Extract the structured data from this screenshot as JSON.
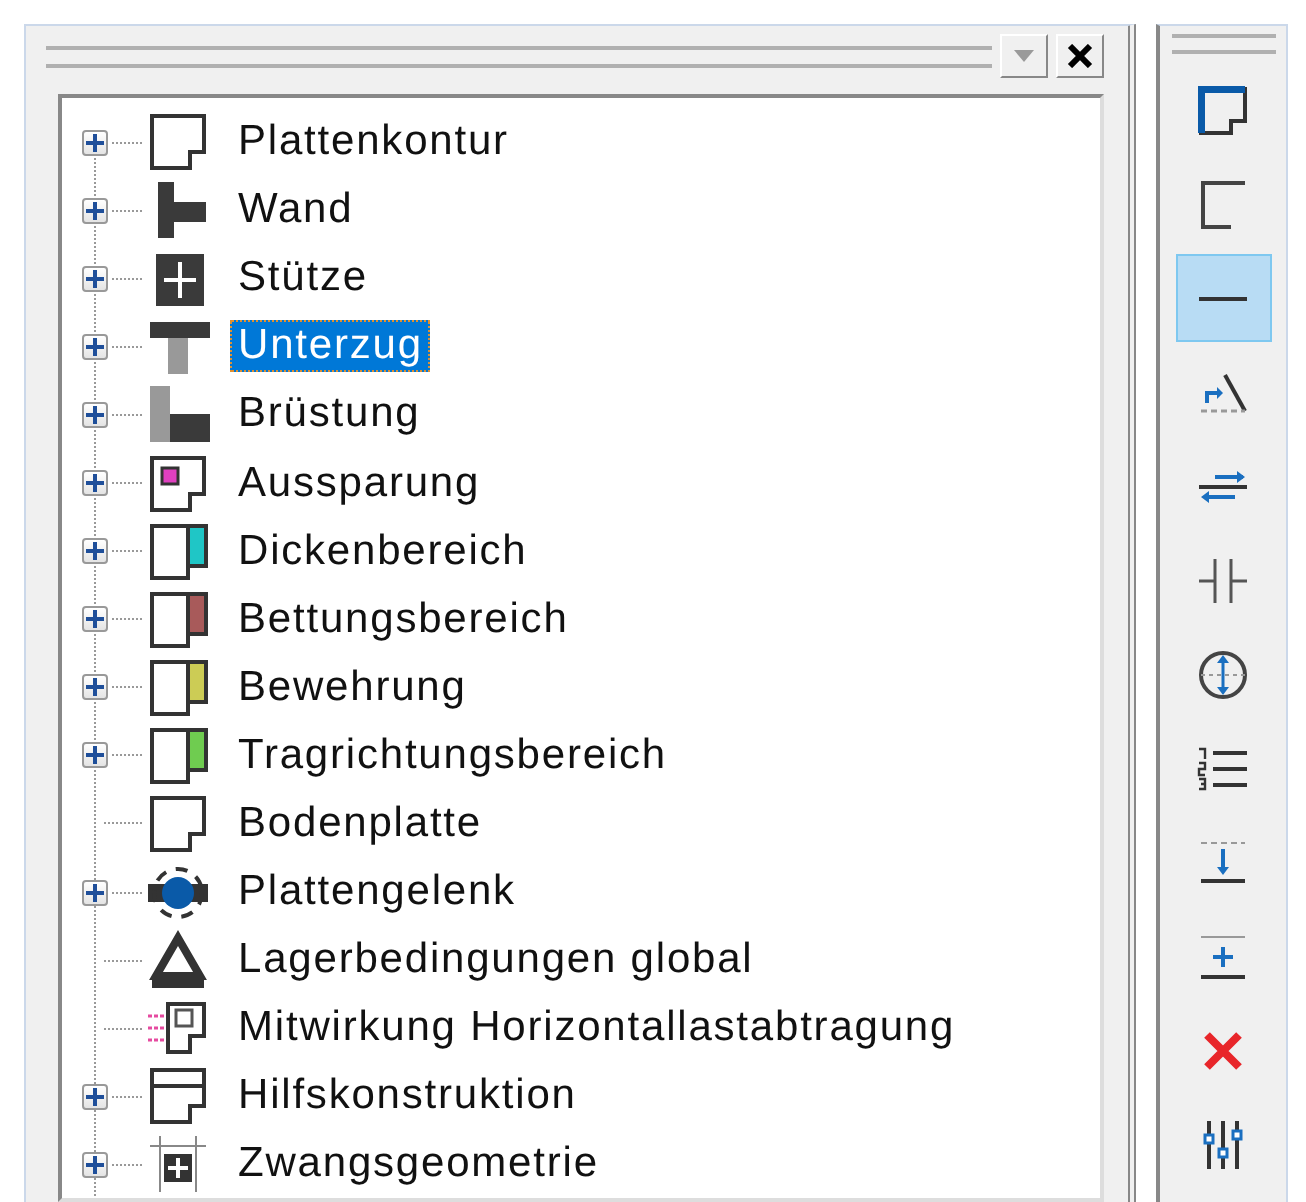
{
  "tree": {
    "items": [
      {
        "label": "Plattenkontur",
        "kind": "contour",
        "expandable": true,
        "selected": false
      },
      {
        "label": "Wand",
        "kind": "wall",
        "expandable": true,
        "selected": false
      },
      {
        "label": "Stütze",
        "kind": "column",
        "expandable": true,
        "selected": false
      },
      {
        "label": "Unterzug",
        "kind": "beam",
        "expandable": true,
        "selected": true
      },
      {
        "label": "Brüstung",
        "kind": "parapet",
        "expandable": true,
        "selected": false
      },
      {
        "label": "Aussparung",
        "kind": "opening",
        "expandable": true,
        "selected": false
      },
      {
        "label": "Dickenbereich",
        "kind": "region",
        "color": "#1fc6c6",
        "expandable": true,
        "selected": false
      },
      {
        "label": "Bettungsbereich",
        "kind": "region",
        "color": "#a85a5a",
        "expandable": true,
        "selected": false
      },
      {
        "label": "Bewehrung",
        "kind": "region",
        "color": "#cccc55",
        "expandable": true,
        "selected": false
      },
      {
        "label": "Tragrichtungsbereich",
        "kind": "region",
        "color": "#6fcc50",
        "expandable": true,
        "selected": false
      },
      {
        "label": "Bodenplatte",
        "kind": "contour",
        "expandable": false,
        "selected": false
      },
      {
        "label": "Plattengelenk",
        "kind": "hinge",
        "expandable": true,
        "selected": false
      },
      {
        "label": "Lagerbedingungen global",
        "kind": "support",
        "expandable": false,
        "selected": false
      },
      {
        "label": "Mitwirkung Horizontallastabtragung",
        "kind": "horizontal",
        "expandable": false,
        "selected": false
      },
      {
        "label": "Hilfskonstruktion",
        "kind": "auxiliary",
        "expandable": true,
        "selected": false
      },
      {
        "label": "Zwangsgeometrie",
        "kind": "constraint",
        "expandable": true,
        "selected": false
      }
    ]
  },
  "toolbar": [
    {
      "kind": "outline",
      "selected": false
    },
    {
      "kind": "open-outline",
      "selected": false
    },
    {
      "kind": "line",
      "selected": true
    },
    {
      "kind": "angle",
      "selected": false
    },
    {
      "kind": "offset",
      "selected": false
    },
    {
      "kind": "split",
      "selected": false
    },
    {
      "kind": "circle",
      "selected": false
    },
    {
      "kind": "numbered",
      "selected": false
    },
    {
      "kind": "move-down",
      "selected": false
    },
    {
      "kind": "add-line",
      "selected": false
    },
    {
      "kind": "delete",
      "selected": false
    },
    {
      "kind": "sliders",
      "selected": false
    }
  ]
}
